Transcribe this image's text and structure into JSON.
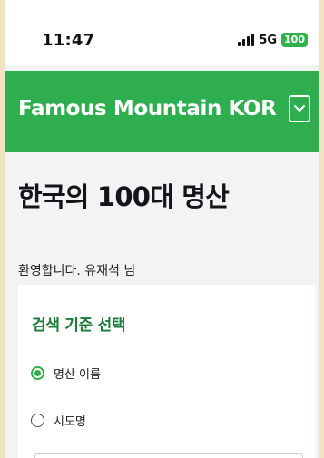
{
  "status_bar": {
    "time": "11:47",
    "network": "5G",
    "battery": "100"
  },
  "app_bar": {
    "title": "Famous Mountain KOR",
    "menu_icon": "chevron-down-square-icon"
  },
  "page": {
    "title": "한국의 100대 명산",
    "welcome": "환영합니다. 유재석 님"
  },
  "search_card": {
    "title": "검색 기준 선택",
    "options": [
      {
        "label": "명산 이름",
        "selected": true
      },
      {
        "label": "시도명",
        "selected": false
      }
    ],
    "search_value": ""
  },
  "colors": {
    "brand_green": "#2fae4f",
    "card_title_green": "#1e7a37",
    "battery_green": "#2fb24a"
  }
}
